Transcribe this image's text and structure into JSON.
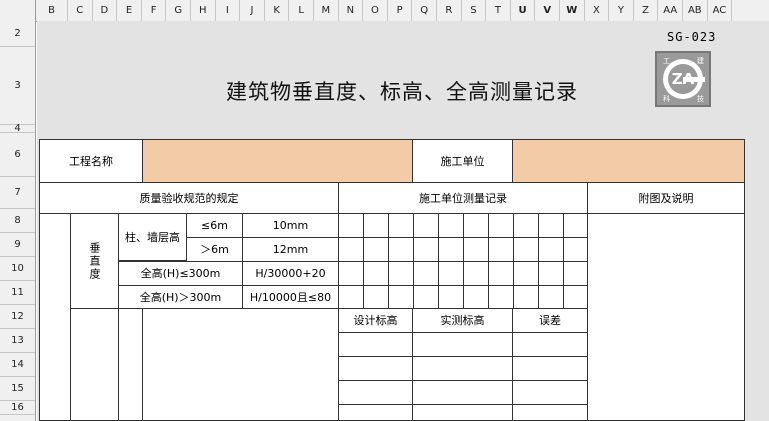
{
  "column_headers": [
    "B",
    "C",
    "D",
    "E",
    "F",
    "G",
    "H",
    "I",
    "J",
    "K",
    "L",
    "M",
    "N",
    "O",
    "P",
    "Q",
    "R",
    "S",
    "T",
    "U",
    "V",
    "W",
    "X",
    "Y",
    "Z",
    "AA",
    "AB",
    "AC"
  ],
  "selected_columns": [
    "U",
    "V",
    "W"
  ],
  "row_headers": [
    "2",
    "3",
    "4",
    "6",
    "7",
    "8",
    "9",
    "10",
    "11",
    "12",
    "13",
    "14",
    "15",
    "16"
  ],
  "form": {
    "code": "SG-023",
    "title": "建筑物垂直度、标高、全高测量记录",
    "logo": {
      "letters": "ZA",
      "corner_marks": [
        "工",
        "建",
        "科",
        "技"
      ]
    },
    "project_name_label": "工程名称",
    "project_name_value": "",
    "construction_unit_label": "施工单位",
    "construction_unit_value": "",
    "spec_header": "质量验收规范的规定",
    "measure_header": "施工单位测量记录",
    "notes_header": "附图及说明",
    "verticality_label": "垂直度",
    "col_wall_label": "柱、墙层高",
    "rows": [
      {
        "cond": "≤6m",
        "limit": "10mm"
      },
      {
        "cond": "＞6m",
        "limit": "12mm"
      },
      {
        "cond": "全高(H)≤300m",
        "limit": "H/30000+20"
      },
      {
        "cond": "全高(H)＞300m",
        "limit": "H/10000且≤80"
      }
    ],
    "elevation_headers": {
      "design": "设计标高",
      "actual": "实测标高",
      "error": "误差"
    }
  },
  "colors": {
    "sheet_bg": "#e3e3e3",
    "input_fill": "#f4cba7",
    "header_bg": "#f0f0f0"
  }
}
